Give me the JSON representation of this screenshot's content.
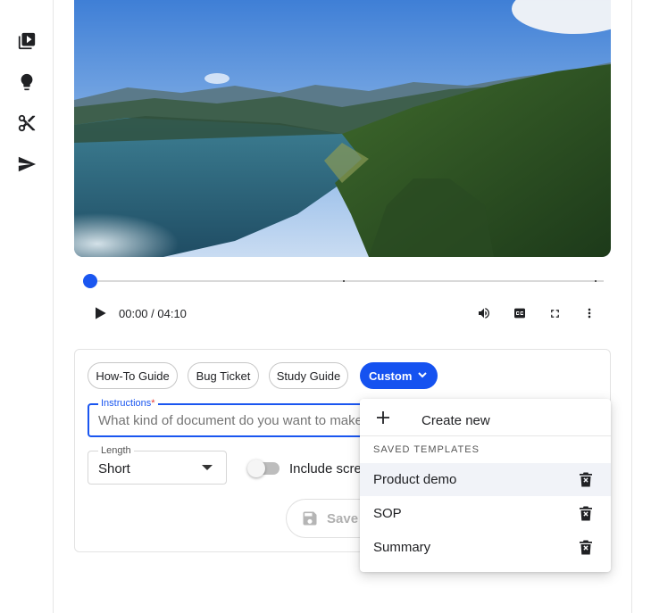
{
  "rail": {
    "icons": [
      "video-library-icon",
      "lightbulb-icon",
      "scissors-icon",
      "send-icon"
    ]
  },
  "player": {
    "time": "00:00 / 04:10",
    "progress_fraction": 0,
    "controls": [
      "play-icon",
      "volume-icon",
      "closed-captions-icon",
      "fullscreen-icon",
      "more-vert-icon"
    ]
  },
  "doc_types": {
    "chips": [
      "How-To Guide",
      "Bug Ticket",
      "Study Guide"
    ],
    "selected": "Custom"
  },
  "instructions": {
    "label": "Instructions",
    "required_mark": "*",
    "placeholder": "What kind of document do you want to make?"
  },
  "length": {
    "label": "Length",
    "value": "Short"
  },
  "include_screenshots": {
    "label": "Include screenshots",
    "enabled": false
  },
  "save": {
    "label": "Save"
  },
  "menu": {
    "create_label": "Create new",
    "section_heading": "SAVED TEMPLATES",
    "templates": [
      "Product demo",
      "SOP",
      "Summary"
    ],
    "highlighted_index": 0
  },
  "colors": {
    "accent": "#1552f0",
    "required": "#e53935"
  }
}
